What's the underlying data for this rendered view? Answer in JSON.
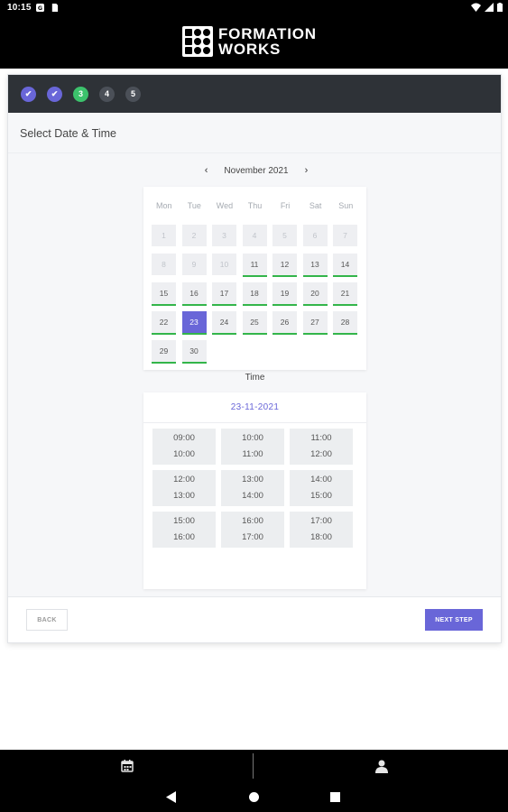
{
  "status_bar": {
    "time": "10:15"
  },
  "brand": {
    "line1": "FORMATION",
    "line2": "WORKS"
  },
  "steps": [
    {
      "label": "✔",
      "state": "done"
    },
    {
      "label": "✔",
      "state": "done"
    },
    {
      "label": "3",
      "state": "active"
    },
    {
      "label": "4",
      "state": "todo"
    },
    {
      "label": "5",
      "state": "todo"
    }
  ],
  "page": {
    "title": "Select Date & Time"
  },
  "calendar": {
    "month_label": "November 2021",
    "prev_symbol": "‹",
    "next_symbol": "›",
    "weekdays": [
      "Mon",
      "Tue",
      "Wed",
      "Thu",
      "Fri",
      "Sat",
      "Sun"
    ],
    "days": [
      {
        "d": "1",
        "s": "disabled"
      },
      {
        "d": "2",
        "s": "disabled"
      },
      {
        "d": "3",
        "s": "disabled"
      },
      {
        "d": "4",
        "s": "disabled"
      },
      {
        "d": "5",
        "s": "disabled"
      },
      {
        "d": "6",
        "s": "disabled"
      },
      {
        "d": "7",
        "s": "disabled"
      },
      {
        "d": "8",
        "s": "disabled"
      },
      {
        "d": "9",
        "s": "disabled"
      },
      {
        "d": "10",
        "s": "disabled"
      },
      {
        "d": "11",
        "s": "available"
      },
      {
        "d": "12",
        "s": "available"
      },
      {
        "d": "13",
        "s": "available"
      },
      {
        "d": "14",
        "s": "available"
      },
      {
        "d": "15",
        "s": "available"
      },
      {
        "d": "16",
        "s": "available"
      },
      {
        "d": "17",
        "s": "available"
      },
      {
        "d": "18",
        "s": "available"
      },
      {
        "d": "19",
        "s": "available"
      },
      {
        "d": "20",
        "s": "available"
      },
      {
        "d": "21",
        "s": "available"
      },
      {
        "d": "22",
        "s": "available"
      },
      {
        "d": "23",
        "s": "selected"
      },
      {
        "d": "24",
        "s": "available"
      },
      {
        "d": "25",
        "s": "available"
      },
      {
        "d": "26",
        "s": "available"
      },
      {
        "d": "27",
        "s": "available"
      },
      {
        "d": "28",
        "s": "available"
      },
      {
        "d": "29",
        "s": "available"
      },
      {
        "d": "30",
        "s": "available"
      }
    ]
  },
  "time_section": {
    "label": "Time",
    "selected_date": "23-11-2021",
    "slots": [
      {
        "start": "09:00",
        "end": "10:00"
      },
      {
        "start": "10:00",
        "end": "11:00"
      },
      {
        "start": "11:00",
        "end": "12:00"
      },
      {
        "start": "12:00",
        "end": "13:00"
      },
      {
        "start": "13:00",
        "end": "14:00"
      },
      {
        "start": "14:00",
        "end": "15:00"
      },
      {
        "start": "15:00",
        "end": "16:00"
      },
      {
        "start": "16:00",
        "end": "17:00"
      },
      {
        "start": "17:00",
        "end": "18:00"
      }
    ]
  },
  "footer": {
    "back_label": "BACK",
    "next_label": "NEXT STEP"
  },
  "tabs": [
    {
      "icon": "calendar-icon"
    },
    {
      "icon": "person-icon"
    }
  ],
  "colors": {
    "accent": "#6966d8",
    "success": "#33b54a",
    "step_active": "#3cc26c"
  }
}
